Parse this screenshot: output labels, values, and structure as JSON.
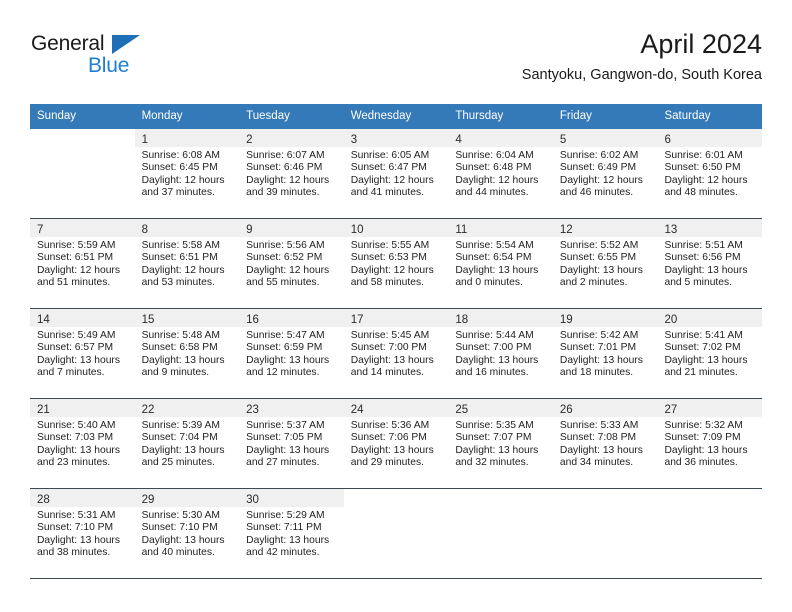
{
  "brand": {
    "name_part1": "General",
    "name_part2": "Blue",
    "triangle_color": "#1f6fb6",
    "blue_color": "#1f7fd0"
  },
  "header": {
    "title": "April 2024",
    "subtitle": "Santyoku, Gangwon-do, South Korea"
  },
  "theme": {
    "header_background": "#3479b8",
    "header_text": "#ffffff",
    "daynum_band": "#f0f0f0",
    "grid_line": "#3d4a52"
  },
  "weekdays": [
    "Sunday",
    "Monday",
    "Tuesday",
    "Wednesday",
    "Thursday",
    "Friday",
    "Saturday"
  ],
  "weeks": [
    [
      {
        "day": "",
        "sunrise": "",
        "sunset": "",
        "daylight_1": "",
        "daylight_2": ""
      },
      {
        "day": "1",
        "sunrise": "Sunrise: 6:08 AM",
        "sunset": "Sunset: 6:45 PM",
        "daylight_1": "Daylight: 12 hours",
        "daylight_2": "and 37 minutes."
      },
      {
        "day": "2",
        "sunrise": "Sunrise: 6:07 AM",
        "sunset": "Sunset: 6:46 PM",
        "daylight_1": "Daylight: 12 hours",
        "daylight_2": "and 39 minutes."
      },
      {
        "day": "3",
        "sunrise": "Sunrise: 6:05 AM",
        "sunset": "Sunset: 6:47 PM",
        "daylight_1": "Daylight: 12 hours",
        "daylight_2": "and 41 minutes."
      },
      {
        "day": "4",
        "sunrise": "Sunrise: 6:04 AM",
        "sunset": "Sunset: 6:48 PM",
        "daylight_1": "Daylight: 12 hours",
        "daylight_2": "and 44 minutes."
      },
      {
        "day": "5",
        "sunrise": "Sunrise: 6:02 AM",
        "sunset": "Sunset: 6:49 PM",
        "daylight_1": "Daylight: 12 hours",
        "daylight_2": "and 46 minutes."
      },
      {
        "day": "6",
        "sunrise": "Sunrise: 6:01 AM",
        "sunset": "Sunset: 6:50 PM",
        "daylight_1": "Daylight: 12 hours",
        "daylight_2": "and 48 minutes."
      }
    ],
    [
      {
        "day": "7",
        "sunrise": "Sunrise: 5:59 AM",
        "sunset": "Sunset: 6:51 PM",
        "daylight_1": "Daylight: 12 hours",
        "daylight_2": "and 51 minutes."
      },
      {
        "day": "8",
        "sunrise": "Sunrise: 5:58 AM",
        "sunset": "Sunset: 6:51 PM",
        "daylight_1": "Daylight: 12 hours",
        "daylight_2": "and 53 minutes."
      },
      {
        "day": "9",
        "sunrise": "Sunrise: 5:56 AM",
        "sunset": "Sunset: 6:52 PM",
        "daylight_1": "Daylight: 12 hours",
        "daylight_2": "and 55 minutes."
      },
      {
        "day": "10",
        "sunrise": "Sunrise: 5:55 AM",
        "sunset": "Sunset: 6:53 PM",
        "daylight_1": "Daylight: 12 hours",
        "daylight_2": "and 58 minutes."
      },
      {
        "day": "11",
        "sunrise": "Sunrise: 5:54 AM",
        "sunset": "Sunset: 6:54 PM",
        "daylight_1": "Daylight: 13 hours",
        "daylight_2": "and 0 minutes."
      },
      {
        "day": "12",
        "sunrise": "Sunrise: 5:52 AM",
        "sunset": "Sunset: 6:55 PM",
        "daylight_1": "Daylight: 13 hours",
        "daylight_2": "and 2 minutes."
      },
      {
        "day": "13",
        "sunrise": "Sunrise: 5:51 AM",
        "sunset": "Sunset: 6:56 PM",
        "daylight_1": "Daylight: 13 hours",
        "daylight_2": "and 5 minutes."
      }
    ],
    [
      {
        "day": "14",
        "sunrise": "Sunrise: 5:49 AM",
        "sunset": "Sunset: 6:57 PM",
        "daylight_1": "Daylight: 13 hours",
        "daylight_2": "and 7 minutes."
      },
      {
        "day": "15",
        "sunrise": "Sunrise: 5:48 AM",
        "sunset": "Sunset: 6:58 PM",
        "daylight_1": "Daylight: 13 hours",
        "daylight_2": "and 9 minutes."
      },
      {
        "day": "16",
        "sunrise": "Sunrise: 5:47 AM",
        "sunset": "Sunset: 6:59 PM",
        "daylight_1": "Daylight: 13 hours",
        "daylight_2": "and 12 minutes."
      },
      {
        "day": "17",
        "sunrise": "Sunrise: 5:45 AM",
        "sunset": "Sunset: 7:00 PM",
        "daylight_1": "Daylight: 13 hours",
        "daylight_2": "and 14 minutes."
      },
      {
        "day": "18",
        "sunrise": "Sunrise: 5:44 AM",
        "sunset": "Sunset: 7:00 PM",
        "daylight_1": "Daylight: 13 hours",
        "daylight_2": "and 16 minutes."
      },
      {
        "day": "19",
        "sunrise": "Sunrise: 5:42 AM",
        "sunset": "Sunset: 7:01 PM",
        "daylight_1": "Daylight: 13 hours",
        "daylight_2": "and 18 minutes."
      },
      {
        "day": "20",
        "sunrise": "Sunrise: 5:41 AM",
        "sunset": "Sunset: 7:02 PM",
        "daylight_1": "Daylight: 13 hours",
        "daylight_2": "and 21 minutes."
      }
    ],
    [
      {
        "day": "21",
        "sunrise": "Sunrise: 5:40 AM",
        "sunset": "Sunset: 7:03 PM",
        "daylight_1": "Daylight: 13 hours",
        "daylight_2": "and 23 minutes."
      },
      {
        "day": "22",
        "sunrise": "Sunrise: 5:39 AM",
        "sunset": "Sunset: 7:04 PM",
        "daylight_1": "Daylight: 13 hours",
        "daylight_2": "and 25 minutes."
      },
      {
        "day": "23",
        "sunrise": "Sunrise: 5:37 AM",
        "sunset": "Sunset: 7:05 PM",
        "daylight_1": "Daylight: 13 hours",
        "daylight_2": "and 27 minutes."
      },
      {
        "day": "24",
        "sunrise": "Sunrise: 5:36 AM",
        "sunset": "Sunset: 7:06 PM",
        "daylight_1": "Daylight: 13 hours",
        "daylight_2": "and 29 minutes."
      },
      {
        "day": "25",
        "sunrise": "Sunrise: 5:35 AM",
        "sunset": "Sunset: 7:07 PM",
        "daylight_1": "Daylight: 13 hours",
        "daylight_2": "and 32 minutes."
      },
      {
        "day": "26",
        "sunrise": "Sunrise: 5:33 AM",
        "sunset": "Sunset: 7:08 PM",
        "daylight_1": "Daylight: 13 hours",
        "daylight_2": "and 34 minutes."
      },
      {
        "day": "27",
        "sunrise": "Sunrise: 5:32 AM",
        "sunset": "Sunset: 7:09 PM",
        "daylight_1": "Daylight: 13 hours",
        "daylight_2": "and 36 minutes."
      }
    ],
    [
      {
        "day": "28",
        "sunrise": "Sunrise: 5:31 AM",
        "sunset": "Sunset: 7:10 PM",
        "daylight_1": "Daylight: 13 hours",
        "daylight_2": "and 38 minutes."
      },
      {
        "day": "29",
        "sunrise": "Sunrise: 5:30 AM",
        "sunset": "Sunset: 7:10 PM",
        "daylight_1": "Daylight: 13 hours",
        "daylight_2": "and 40 minutes."
      },
      {
        "day": "30",
        "sunrise": "Sunrise: 5:29 AM",
        "sunset": "Sunset: 7:11 PM",
        "daylight_1": "Daylight: 13 hours",
        "daylight_2": "and 42 minutes."
      },
      {
        "day": "",
        "sunrise": "",
        "sunset": "",
        "daylight_1": "",
        "daylight_2": ""
      },
      {
        "day": "",
        "sunrise": "",
        "sunset": "",
        "daylight_1": "",
        "daylight_2": ""
      },
      {
        "day": "",
        "sunrise": "",
        "sunset": "",
        "daylight_1": "",
        "daylight_2": ""
      },
      {
        "day": "",
        "sunrise": "",
        "sunset": "",
        "daylight_1": "",
        "daylight_2": ""
      }
    ]
  ]
}
